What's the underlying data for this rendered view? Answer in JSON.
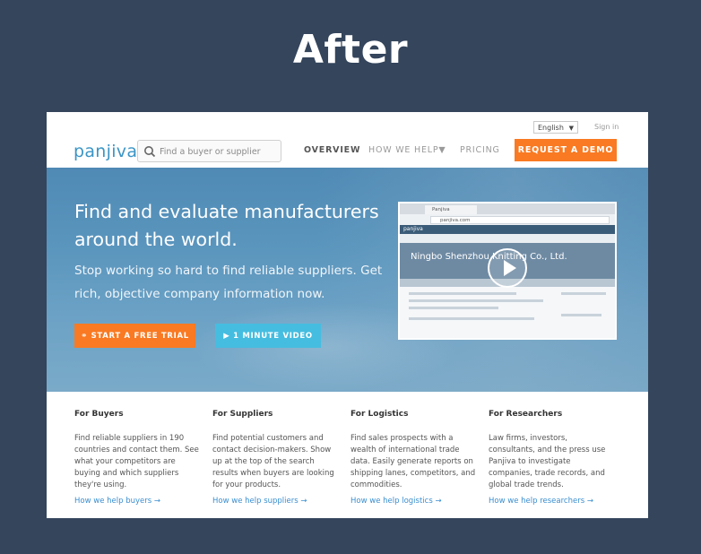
{
  "caption": "After",
  "header": {
    "language": "English",
    "signin": "Sign in",
    "logo": "panjiva",
    "search_placeholder": "Find a buyer or supplier",
    "nav": {
      "overview": "OVERVIEW",
      "how_we_help": "HOW WE HELP▼",
      "pricing": "PRICING"
    },
    "demo_button": "REQUEST A DEMO"
  },
  "hero": {
    "headline": "Find and evaluate manufacturers around the world.",
    "subheadline": "Stop working so hard to find reliable suppliers. Get rich, objective company information now.",
    "trial_button": "START A FREE TRIAL",
    "video_button": "1 MINUTE VIDEO",
    "video": {
      "tab_title": "Panjiva",
      "url": "panjiva.com",
      "app_logo": "panjiva",
      "company_name": "Ningbo Shenzhou Knitting Co., Ltd."
    }
  },
  "columns": [
    {
      "title": "For Buyers",
      "text": "Find reliable suppliers in 190 countries and contact them. See what your competitors are buying and which suppliers they're using.",
      "link": "How we help buyers →"
    },
    {
      "title": "For Suppliers",
      "text": "Find potential customers and contact decision-makers. Show up at the top of the search results when buyers are looking for your products.",
      "link": "How we help suppliers →"
    },
    {
      "title": "For Logistics",
      "text": "Find sales prospects with a wealth of international trade data. Easily generate reports on shipping lanes, competitors, and commodities.",
      "link": "How we help logistics →"
    },
    {
      "title": "For Researchers",
      "text": "Law firms, investors, consultants, and the press use Panjiva to investigate companies, trade records, and global trade trends.",
      "link": "How we help researchers →"
    }
  ],
  "colors": {
    "background": "#34455c",
    "accent_orange": "#f97a22",
    "accent_cyan": "#45bde0",
    "link_blue": "#3b8fd0"
  }
}
